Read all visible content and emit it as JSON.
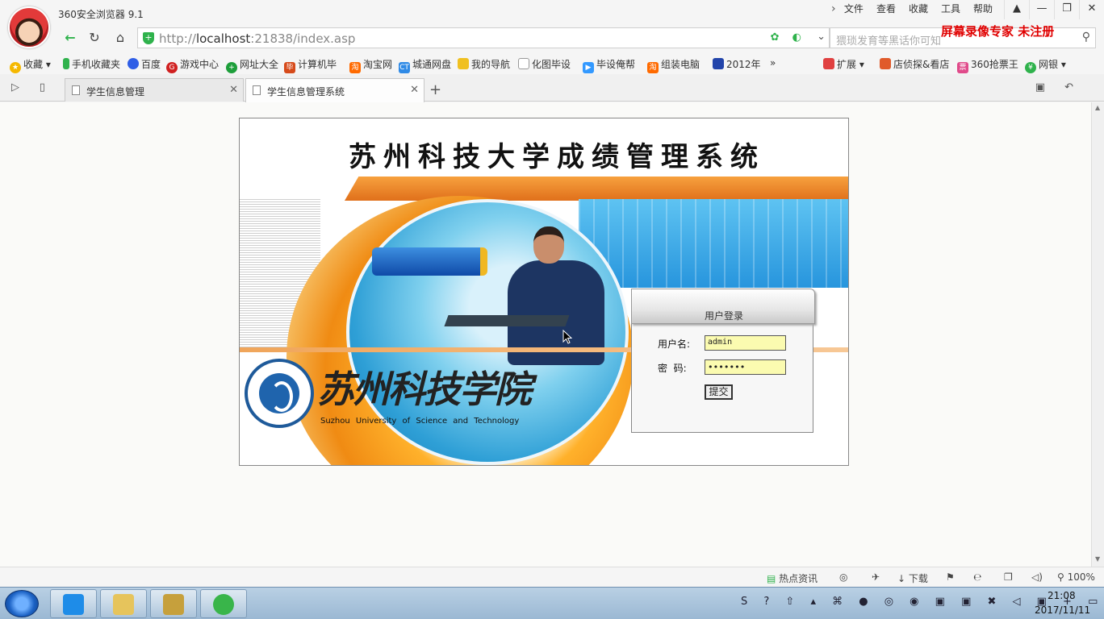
{
  "browser": {
    "app_title": "360安全浏览器 9.1",
    "menu": [
      "文件",
      "查看",
      "收藏",
      "工具",
      "帮助"
    ],
    "url_prefix": "http://",
    "url_host": "localhost",
    "url_rest": ":21838/index.asp",
    "search_placeholder": "猥琐发育等黑话你可知",
    "recorder_watermark": "屏幕录像专家  未注册"
  },
  "bookmarks": [
    {
      "label": "收藏",
      "color": "#f5b800"
    },
    {
      "label": "手机收藏夹",
      "color": "#2fb24c"
    },
    {
      "label": "百度",
      "color": "#2f5ee6"
    },
    {
      "label": "游戏中心",
      "color": "#d02020"
    },
    {
      "label": "网址大全",
      "color": "#1d9e3a"
    },
    {
      "label": "计算机毕",
      "color": "#d64a1a"
    },
    {
      "label": "淘宝网",
      "color": "#ff6a00"
    },
    {
      "label": "城通网盘",
      "color": "#2f8ae6"
    },
    {
      "label": "我的导航",
      "color": "#f0c020"
    },
    {
      "label": "化图毕设",
      "color": "#bbbbbb"
    },
    {
      "label": "毕设俺帮",
      "color": "#3399ff"
    },
    {
      "label": "组装电脑",
      "color": "#ff6a00"
    },
    {
      "label": "2012年",
      "color": "#2244aa"
    }
  ],
  "bookmarks_right": [
    {
      "label": "扩展",
      "color": "#e04040"
    },
    {
      "label": "店侦探&看店",
      "color": "#e05a2a"
    },
    {
      "label": "360抢票王",
      "color": "#e04a8a"
    },
    {
      "label": "网银",
      "color": "#2fb24c"
    }
  ],
  "tabs": [
    {
      "title": "学生信息管理",
      "active": false
    },
    {
      "title": "学生信息管理系统",
      "active": true
    }
  ],
  "page": {
    "system_title": "苏州科技大学成绩管理系统",
    "logo_cn": "苏州科技学院",
    "logo_en": "Suzhou University of Science and Technology",
    "login": {
      "title": "用户登录",
      "username_label": "用户名:",
      "username_value": "admin",
      "password_label": "密  码:",
      "password_value": "•••••••",
      "submit_label": "提交"
    }
  },
  "statusbar": {
    "news": "热点资讯",
    "download": "下载",
    "zoom": "100%"
  },
  "taskbar": {
    "time": "21:08",
    "date": "2017/11/11"
  }
}
